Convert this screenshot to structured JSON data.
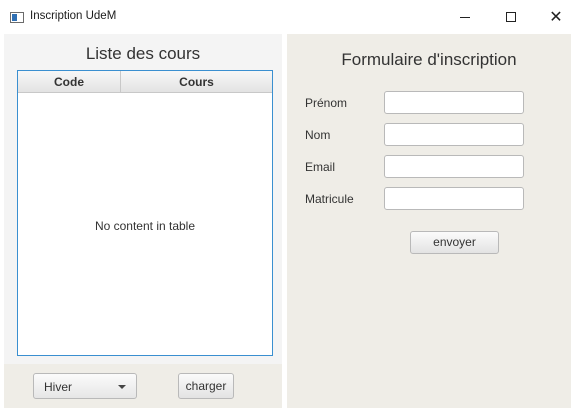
{
  "window": {
    "title": "Inscription UdeM",
    "minimize_glyph": "—",
    "close_glyph": "✕"
  },
  "course_list": {
    "title": "Liste des cours",
    "columns": [
      "Code",
      "Cours"
    ],
    "rows": [],
    "empty_message": "No content in table",
    "semester_select": {
      "value": "Hiver"
    },
    "load_button": "charger"
  },
  "form": {
    "title": "Formulaire d'inscription",
    "fields": [
      {
        "label": "Prénom",
        "value": ""
      },
      {
        "label": "Nom",
        "value": ""
      },
      {
        "label": "Email",
        "value": ""
      },
      {
        "label": "Matricule",
        "value": ""
      }
    ],
    "submit_button": "envoyer"
  },
  "colors": {
    "table_focus_border": "#3a8fd0",
    "panel_background": "#efede7"
  },
  "icons": [
    "app-window-icon",
    "minimize-icon",
    "maximize-icon",
    "close-icon",
    "dropdown-arrow-icon"
  ]
}
